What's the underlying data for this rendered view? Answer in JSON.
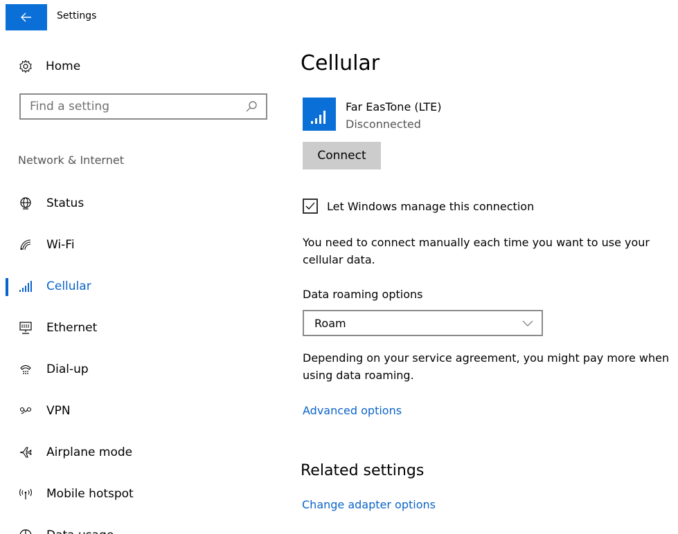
{
  "window": {
    "title": "Settings",
    "back_icon": "back-arrow-icon"
  },
  "sidebar": {
    "home_label": "Home",
    "home_icon": "gear-icon",
    "search_placeholder": "Find a setting",
    "section_title": "Network & Internet",
    "items": [
      {
        "label": "Status",
        "icon": "globe-icon",
        "active": false
      },
      {
        "label": "Wi-Fi",
        "icon": "wifi-icon",
        "active": false
      },
      {
        "label": "Cellular",
        "icon": "cellular-signal-icon",
        "active": true
      },
      {
        "label": "Ethernet",
        "icon": "ethernet-icon",
        "active": false
      },
      {
        "label": "Dial-up",
        "icon": "dialup-icon",
        "active": false
      },
      {
        "label": "VPN",
        "icon": "vpn-icon",
        "active": false
      },
      {
        "label": "Airplane mode",
        "icon": "airplane-icon",
        "active": false
      },
      {
        "label": "Mobile hotspot",
        "icon": "hotspot-icon",
        "active": false
      },
      {
        "label": "Data usage",
        "icon": "data-usage-icon",
        "active": false
      }
    ]
  },
  "main": {
    "title": "Cellular",
    "network": {
      "name": "Far EasTone (LTE)",
      "status": "Disconnected"
    },
    "connect_label": "Connect",
    "manage_checkbox": {
      "label": "Let Windows manage this connection",
      "checked": true
    },
    "manage_description": "You need to connect manually each time you want to use your cellular data.",
    "roaming": {
      "label": "Data roaming options",
      "selected": "Roam",
      "description": "Depending on your service agreement, you might pay more when using data roaming."
    },
    "advanced_link": "Advanced options",
    "related_title": "Related settings",
    "adapter_link": "Change adapter options"
  },
  "colors": {
    "accent": "#0a63c9",
    "tile": "#0a6fd6",
    "button": "#cccccc"
  }
}
